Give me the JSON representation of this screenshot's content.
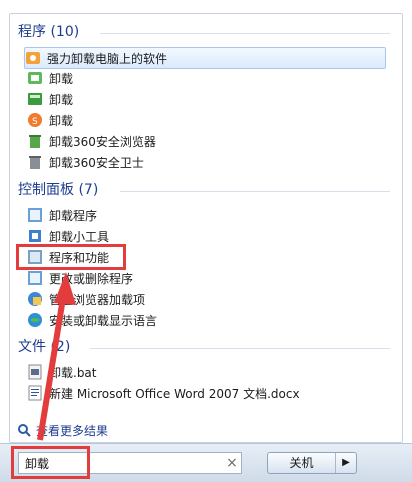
{
  "sections": {
    "programs": {
      "header": "程序 (10)",
      "items": [
        {
          "label": "强力卸载电脑上的软件",
          "icon": "software-remove-icon"
        },
        {
          "label": "卸载",
          "icon": "uninstall-green-icon"
        },
        {
          "label": "卸载",
          "icon": "uninstall-box-icon"
        },
        {
          "label": "卸载",
          "icon": "uninstall-orange-icon"
        },
        {
          "label": "卸载360安全浏览器",
          "icon": "recycle-bin-icon"
        },
        {
          "label": "卸载360安全卫士",
          "icon": "recycle-bin-icon"
        }
      ]
    },
    "control_panel": {
      "header": "控制面板 (7)",
      "items": [
        {
          "label": "卸载程序",
          "icon": "control-panel-icon"
        },
        {
          "label": "卸载小工具",
          "icon": "gadget-icon"
        },
        {
          "label": "程序和功能",
          "icon": "programs-features-icon"
        },
        {
          "label": "更改或删除程序",
          "icon": "control-panel-icon"
        },
        {
          "label": "管理浏览器加载项",
          "icon": "browser-addon-icon"
        },
        {
          "label": "安装或卸载显示语言",
          "icon": "globe-icon"
        }
      ]
    },
    "files": {
      "header": "文件 (2)",
      "items": [
        {
          "label": "卸载.bat",
          "icon": "bat-file-icon"
        },
        {
          "label": "新建 Microsoft Office Word 2007 文档.docx",
          "icon": "docx-file-icon"
        }
      ]
    }
  },
  "see_more": "查看更多结果",
  "search": {
    "value": "卸载",
    "clear": "×"
  },
  "shutdown": {
    "label": "关机",
    "arrow": "▶"
  },
  "colors": {
    "annotation": "#e23c3c",
    "header": "#1e3d8f"
  }
}
